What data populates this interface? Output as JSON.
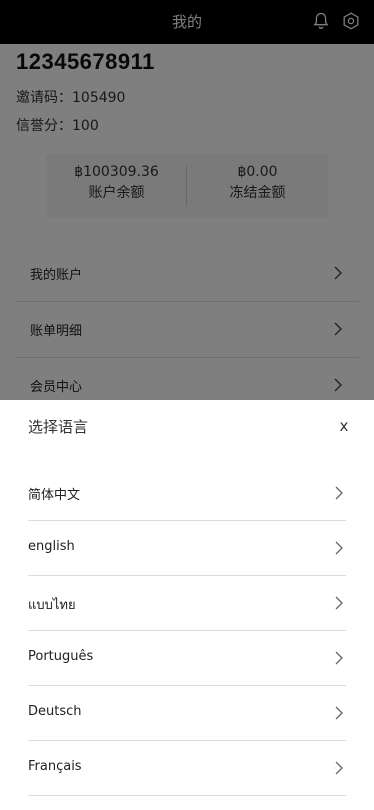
{
  "header": {
    "title": "我的"
  },
  "profile": {
    "user_id": "12345678911",
    "invite_code_label": "邀请码：",
    "invite_code": "105490",
    "credit_label": "信誉分：",
    "credit_score": "100"
  },
  "balances": {
    "account": {
      "amount": "฿100309.36",
      "label": "账户余额"
    },
    "frozen": {
      "amount": "฿0.00",
      "label": "冻结金额"
    }
  },
  "menu": {
    "items": [
      {
        "label": "我的账户"
      },
      {
        "label": "账单明细"
      },
      {
        "label": "会员中心"
      }
    ]
  },
  "language_sheet": {
    "title": "选择语言",
    "close": "x",
    "options": [
      {
        "label": "简体中文"
      },
      {
        "label": "english"
      },
      {
        "label": "แบบไทย"
      },
      {
        "label": "Português"
      },
      {
        "label": "Deutsch"
      },
      {
        "label": "Français"
      }
    ]
  },
  "icons": {
    "bell": "bell-icon",
    "settings": "gear-icon",
    "chevron": "chevron-right-icon"
  }
}
